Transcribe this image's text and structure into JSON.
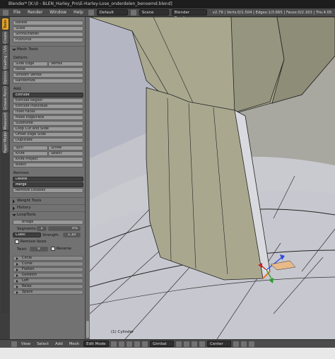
{
  "window": {
    "title": "Blender* [K:\\0 - BLEN_Harley_Pro\\E-Harley-Lose_onderdelen_benoemd.blend]"
  },
  "menubar": {
    "items": [
      "File",
      "Render",
      "Window",
      "Help"
    ],
    "layout": "Default",
    "scene": "Scene",
    "engine": "Blender Render",
    "info": "v2.79 | Verts:0/1.504 | Edges:1/3.665 | Faces:0/2.163 | Tris:4.05"
  },
  "tabs": [
    "Tools",
    "Create",
    "Shading / UVs",
    "Options",
    "Grease Pencil",
    "Measureit",
    "Paper Model"
  ],
  "panel": {
    "transform": [
      "Rotate",
      "Scale",
      "Shrink/Fatten",
      "Push/Pull"
    ],
    "mesh_tools_header": "Mesh Tools",
    "deform_label": "Deform:",
    "slide_edge": "Slide Edge",
    "vertex": "Vertex",
    "noise": "Noise",
    "smooth_vertex": "Smooth Vertex",
    "randomize": "Randomize",
    "add_label": "Add:",
    "extrude": "Extrude",
    "extrude_region": "Extrude Region",
    "extrude_individual": "Extrude Individual",
    "inset_faces": "Inset Faces",
    "make_edge_face": "Make Edge/Face",
    "subdivide": "Subdivide",
    "loop_cut": "Loop Cut and Slide",
    "offset_edge": "Offset Edge Slide",
    "duplicate": "Duplicate",
    "spin": "Spin",
    "screw": "Screw",
    "knife": "Knife",
    "select": "Select",
    "knife_project": "Knife Project",
    "bisect": "Bisect",
    "remove_label": "Remove:",
    "delete": "Delete",
    "merge": "Merge",
    "remove_doubles": "Remove Doubles",
    "weight_tools": "Weight Tools",
    "history": "History",
    "looptools": "LoopTools",
    "bridge": "Bridge",
    "segments_label": "Segments:",
    "segments_value": "1",
    "pct": "0%",
    "interp": "Cubic",
    "strength_label": "Strength:",
    "strength_value": "1.10",
    "remove_faces": "Remove faces",
    "twist_label": "Twist:",
    "twist_value": "0",
    "reverse": "Reverse",
    "loop_items": [
      "Circle",
      "Curve",
      "Flatten",
      "Gstretch",
      "Loft",
      "Relax",
      "Space"
    ]
  },
  "viewport": {
    "object_label": "(1) Cylinder"
  },
  "bottombar": {
    "items": [
      "View",
      "Select",
      "Add",
      "Mesh"
    ],
    "mode": "Edit Mode",
    "orientation": "Gimbal",
    "pivot": "Center"
  },
  "colors": {
    "accent": "#e5a426",
    "panel": "#727272",
    "viewport_bg": "#3d3d3d",
    "mesh_face": "#a9a88f"
  }
}
